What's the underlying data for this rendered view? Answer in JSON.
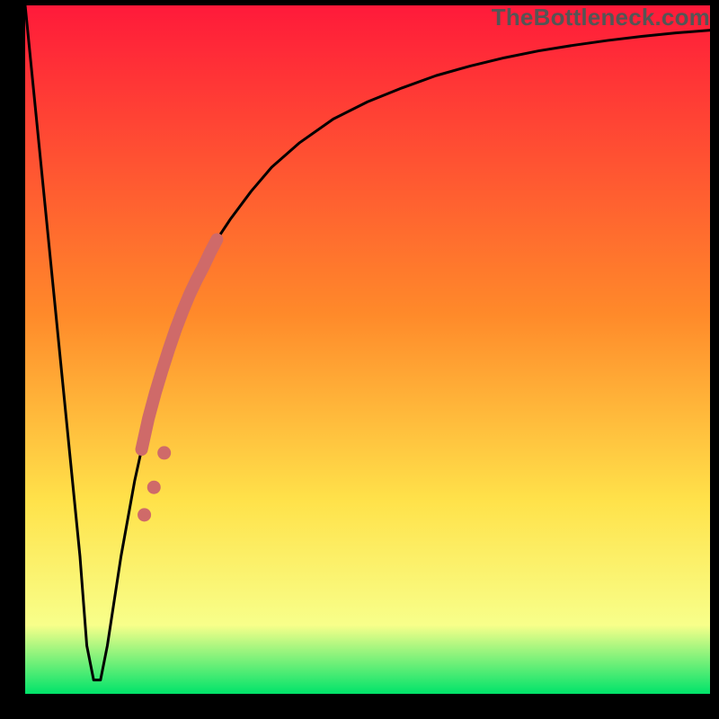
{
  "watermark": "TheBottleneck.com",
  "colors": {
    "frame": "#000000",
    "curve": "#000000",
    "highlight": "#cf6a69",
    "gradient_top": "#ff1a3a",
    "gradient_mid1": "#ff8a2a",
    "gradient_mid2": "#ffe24a",
    "gradient_mid3": "#f8ff8a",
    "gradient_bottom": "#00e36a"
  },
  "chart_data": {
    "type": "line",
    "title": "",
    "xlabel": "",
    "ylabel": "",
    "xlim": [
      0,
      100
    ],
    "ylim": [
      0,
      100
    ],
    "x": [
      0,
      2,
      4,
      6,
      8,
      9,
      10,
      11,
      12,
      14,
      16,
      18,
      20,
      22,
      24,
      26,
      28,
      30,
      33,
      36,
      40,
      45,
      50,
      55,
      60,
      65,
      70,
      75,
      80,
      85,
      90,
      95,
      100
    ],
    "values": [
      100,
      80,
      60,
      40,
      20,
      7,
      2,
      2,
      7,
      20,
      31,
      40,
      47,
      53,
      58,
      62,
      66,
      69,
      73,
      76.5,
      80,
      83.5,
      86,
      88,
      89.8,
      91.2,
      92.4,
      93.4,
      94.2,
      94.9,
      95.5,
      96,
      96.4
    ],
    "highlight_segment": {
      "x": [
        17,
        18,
        19,
        20,
        21,
        22,
        23,
        24,
        25,
        26,
        27,
        28
      ],
      "values": [
        35.5,
        40,
        43.7,
        47,
        50.1,
        53,
        55.6,
        58,
        60.1,
        62,
        64.1,
        66
      ]
    },
    "highlight_dots": {
      "x": [
        17.4,
        18.8,
        20.3
      ],
      "values": [
        26,
        30,
        35
      ]
    },
    "annotations": []
  }
}
